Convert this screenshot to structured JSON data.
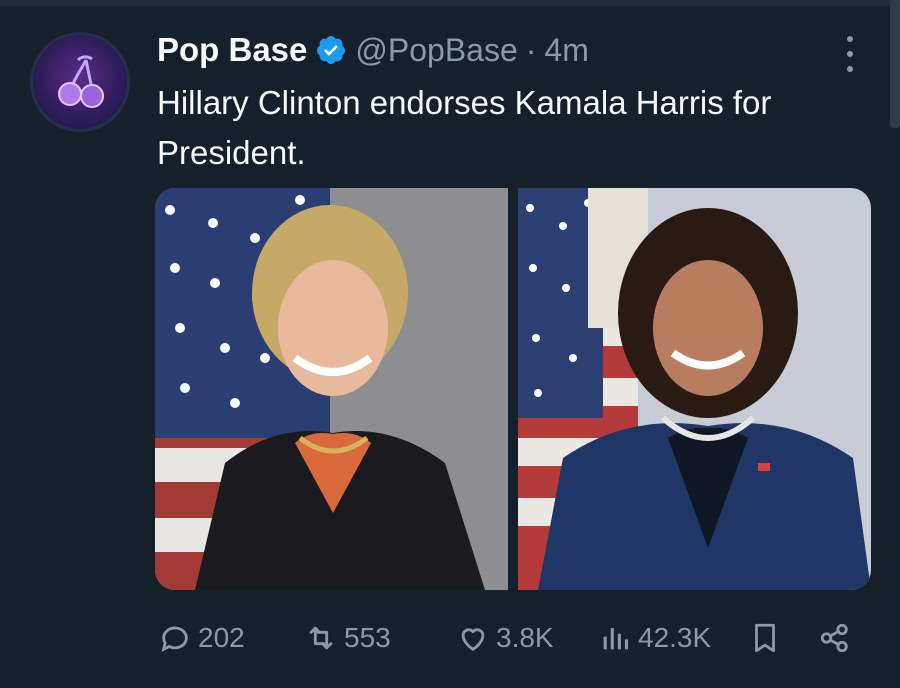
{
  "tweet": {
    "author_name": "Pop Base",
    "handle": "@PopBase",
    "separator": "·",
    "time": "4m",
    "text": "Hillary Clinton endorses Kamala Harris for President.",
    "stats": {
      "replies": "202",
      "reposts": "553",
      "likes": "3.8K",
      "views": "42.3K"
    }
  },
  "icons": {
    "avatar": "cherry-icon",
    "verified": "verified-badge-icon",
    "more": "more-vertical-icon",
    "reply": "reply-icon",
    "repost": "repost-icon",
    "like": "heart-icon",
    "views": "views-icon",
    "bookmark": "bookmark-icon",
    "share": "share-icon"
  },
  "colors": {
    "background": "#15202b",
    "text": "#f7f9f9",
    "muted": "#8b98a5",
    "verified": "#1d9bf0"
  }
}
